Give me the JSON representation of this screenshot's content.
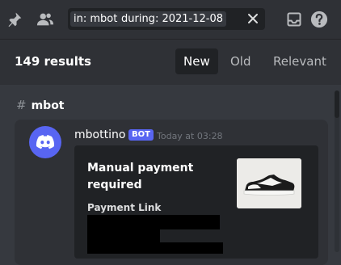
{
  "search": {
    "filter_in": "in: mbot",
    "filter_during": "during: 2021-12-08"
  },
  "icons": {
    "pin": "pin-icon",
    "members": "members-icon",
    "clear": "close-icon",
    "inbox": "inbox-icon",
    "help": "help-icon"
  },
  "results": {
    "count_label": "149 results",
    "sort_tabs": [
      {
        "label": "New",
        "active": true
      },
      {
        "label": "Old",
        "active": false
      },
      {
        "label": "Relevant",
        "active": false
      }
    ]
  },
  "channel": {
    "hash": "#",
    "name": "mbot"
  },
  "message": {
    "author": "mbottino",
    "bot_tag": "BOT",
    "timestamp": "Today at 03:28",
    "embed": {
      "title": "Manual payment required",
      "field_name": "Payment Link"
    }
  },
  "colors": {
    "accent": "#5865f2",
    "background": "#36393f",
    "panel": "#2f3136",
    "input": "#202225"
  }
}
